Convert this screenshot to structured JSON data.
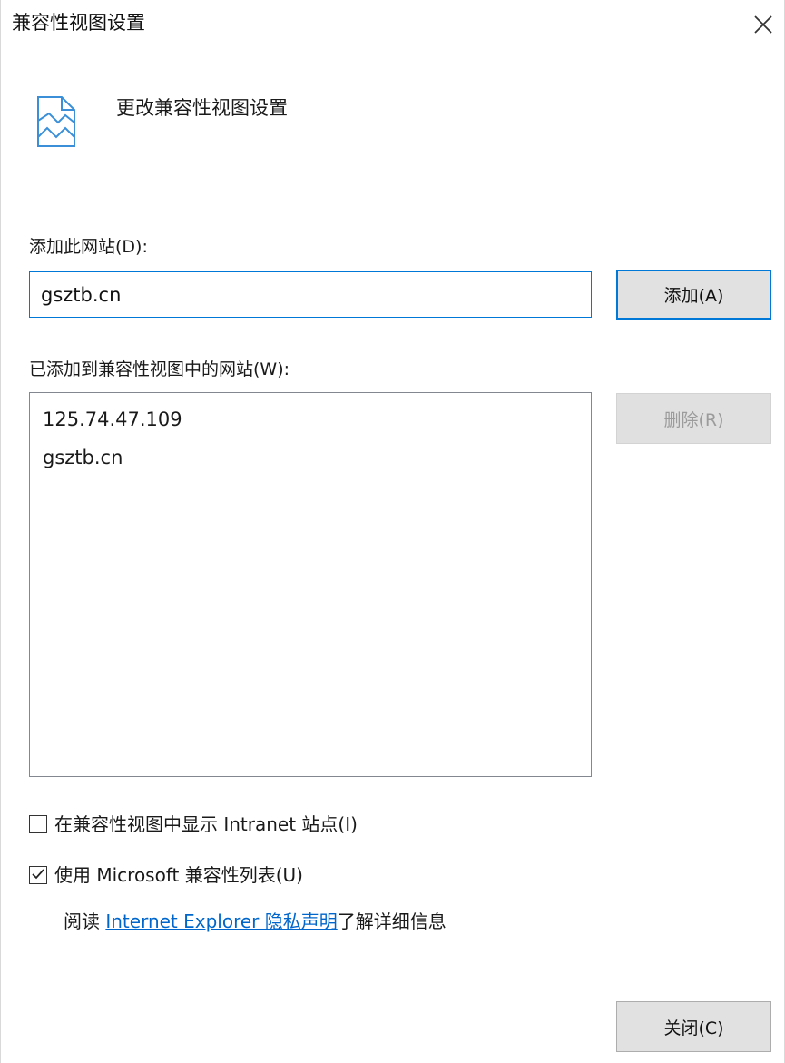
{
  "window": {
    "title": "兼容性视图设置",
    "close_icon": "close-icon"
  },
  "header": {
    "icon": "compat-view-page-icon",
    "text": "更改兼容性视图设置"
  },
  "add_site": {
    "label": "添加此网站(D):",
    "input_value": "gsztb.cn",
    "add_button": "添加(A)"
  },
  "site_list": {
    "label": "已添加到兼容性视图中的网站(W):",
    "items": [
      "125.74.47.109",
      "gsztb.cn"
    ],
    "remove_button": "删除(R)"
  },
  "options": {
    "intranet": {
      "label": "在兼容性视图中显示 Intranet 站点(I)",
      "checked": false
    },
    "ms_list": {
      "label": "使用 Microsoft 兼容性列表(U)",
      "checked": true
    }
  },
  "privacy": {
    "prefix": "阅读 ",
    "link": "Internet Explorer 隐私声明",
    "suffix": "了解详细信息"
  },
  "footer": {
    "close_button": "关闭(C)"
  },
  "colors": {
    "accent": "#0078d7",
    "link": "#0066cc",
    "disabled_text": "#9b9b9b"
  }
}
